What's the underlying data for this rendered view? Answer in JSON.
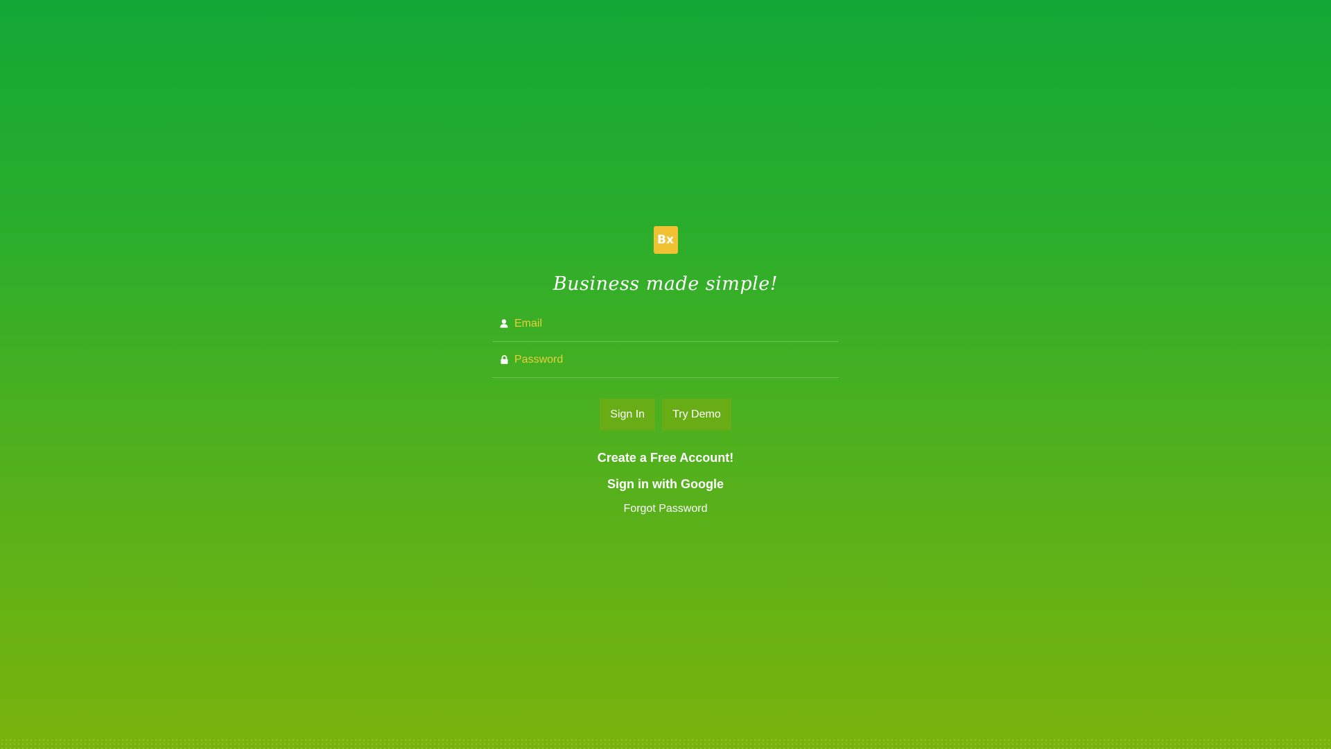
{
  "brand": {
    "logo_text": "Bx",
    "logo_color": "#f0c233",
    "tagline": "Business made simple!"
  },
  "form": {
    "email": {
      "placeholder": "Email",
      "value": "",
      "icon": "user-icon"
    },
    "password": {
      "placeholder": "Password",
      "value": "",
      "icon": "lock-icon"
    }
  },
  "buttons": {
    "sign_in": "Sign In",
    "try_demo": "Try Demo"
  },
  "links": {
    "create_account": "Create a Free Account!",
    "google_sign_in": "Sign in with Google",
    "forgot_password": "Forgot Password"
  },
  "colors": {
    "background_top": "#12a736",
    "background_bottom": "#7ab30c",
    "placeholder": "#e8cf3a",
    "button": "#68ad16"
  }
}
